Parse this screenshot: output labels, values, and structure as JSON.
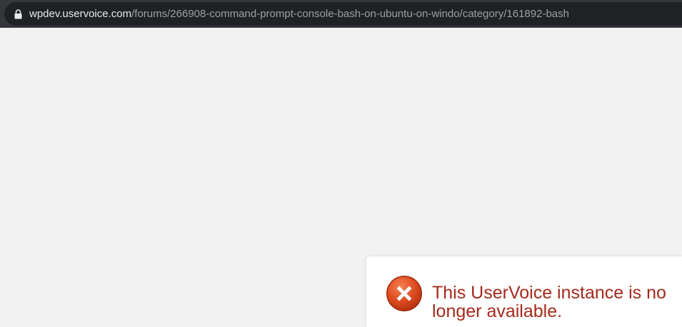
{
  "browser": {
    "url_host": "wpdev.uservoice.com",
    "url_path": "/forums/266908-command-prompt-console-bash-on-ubuntu-on-windo/category/161892-bash",
    "secure_icon": "lock-icon"
  },
  "notice": {
    "icon": "error-x-icon",
    "message": "This UserVoice instance is no longer available."
  },
  "colors": {
    "page_background": "#f2f2f2",
    "notice_text": "#a52a1a",
    "error_icon": "#d9411e"
  }
}
